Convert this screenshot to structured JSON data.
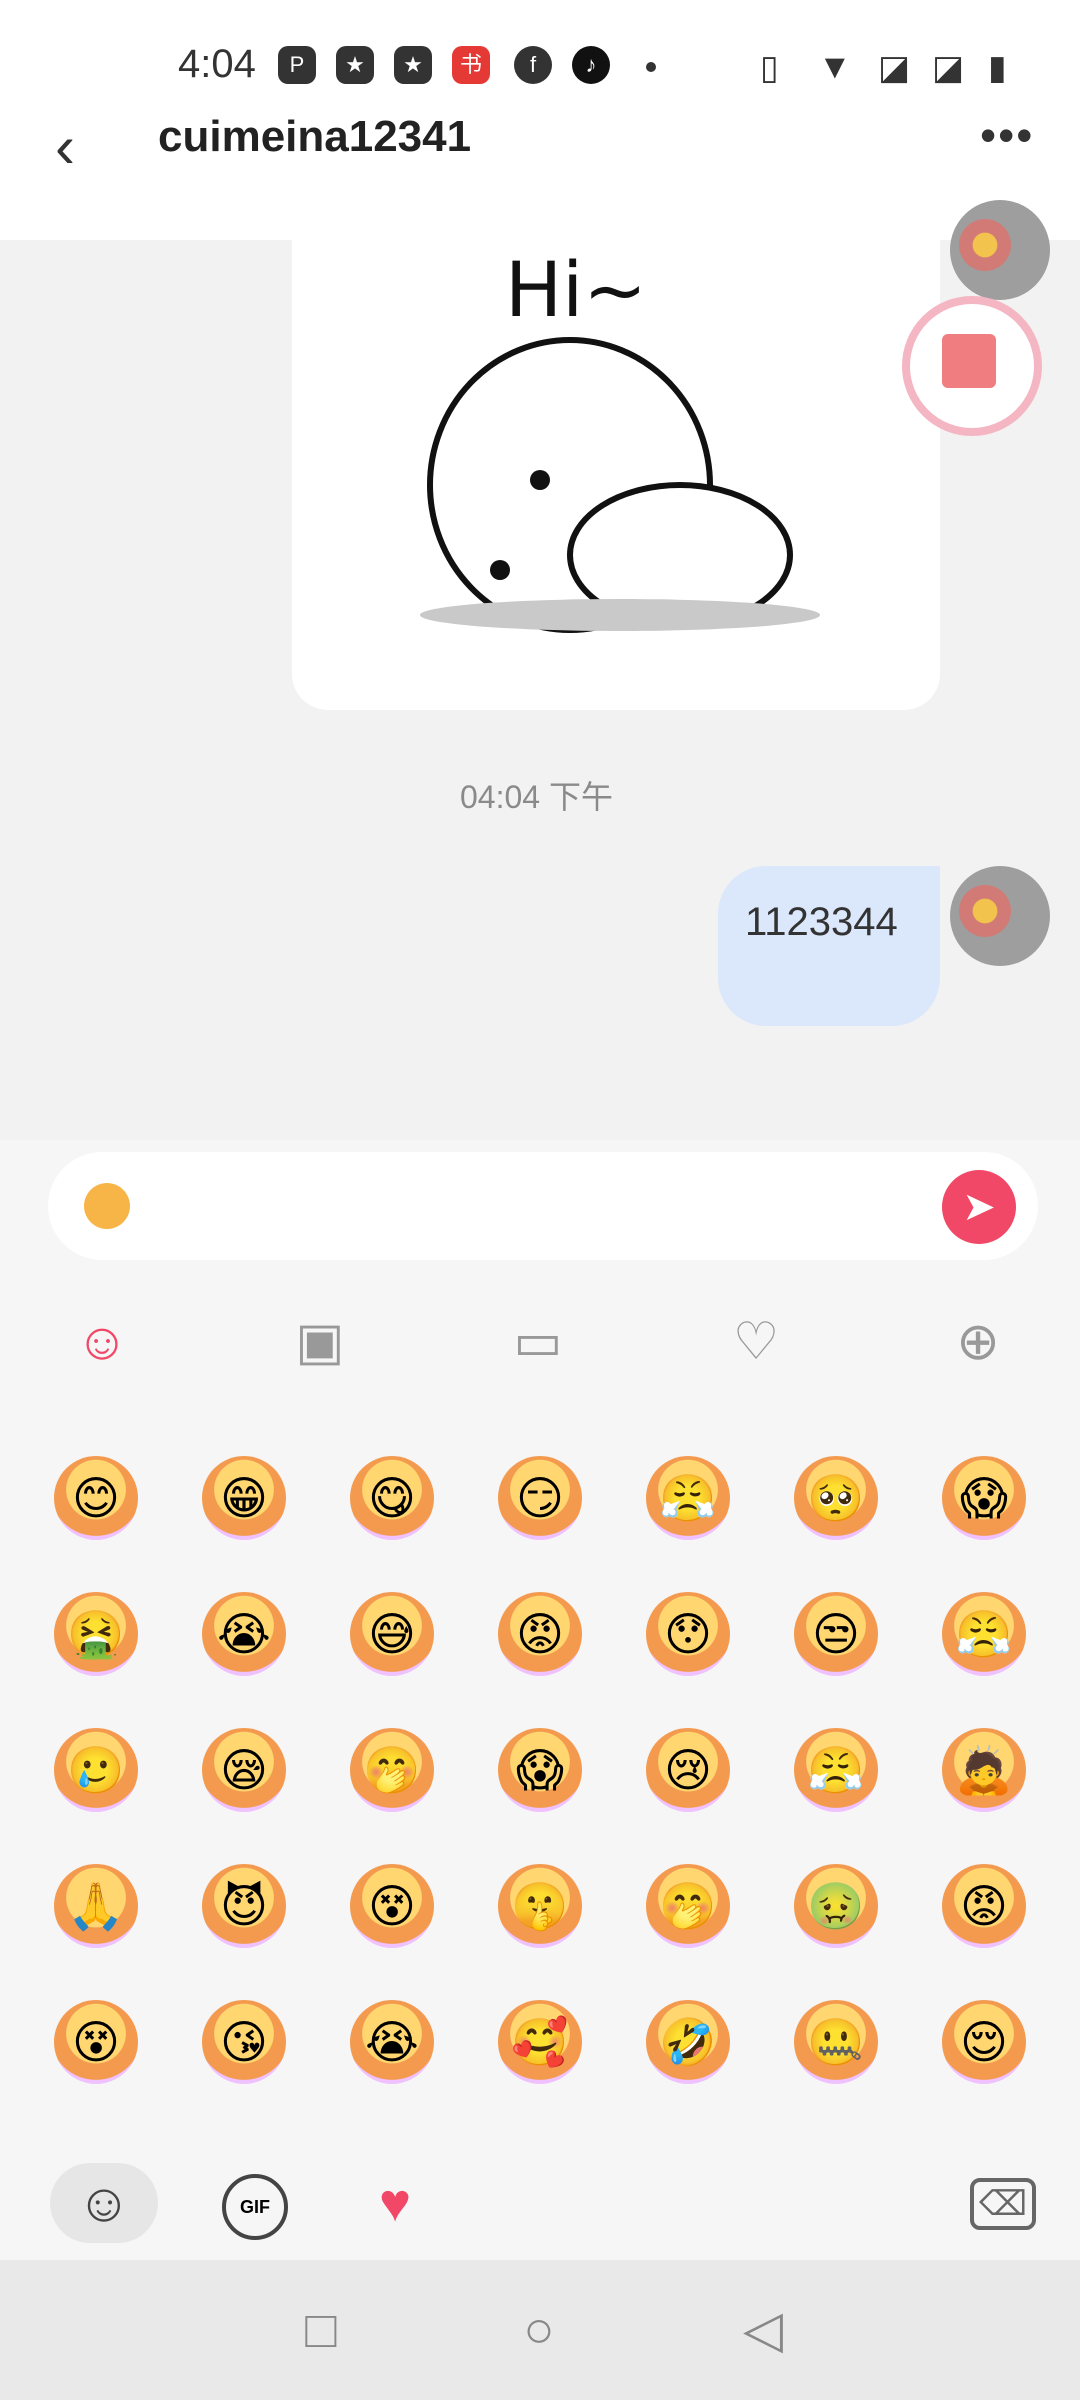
{
  "status": {
    "time": "4:04"
  },
  "header": {
    "title": "cuimeina12341"
  },
  "chat": {
    "sticker_text": "Hi~",
    "timestamp": "04:04 下午",
    "sent_message": "1123344"
  },
  "composer": {
    "value_icon": "smiling-face-emoji",
    "send_icon": "send-arrow-icon"
  },
  "toolbar": {
    "items": [
      "emoji-icon",
      "image-icon",
      "gift-icon",
      "broken-heart-icon",
      "plus-icon"
    ]
  },
  "emoji_grid": {
    "rows": [
      [
        "😊",
        "😁",
        "😋",
        "😏",
        "😤",
        "🥺",
        "😱"
      ],
      [
        "🤮",
        "😭",
        "😅",
        "😡",
        "😯",
        "😒",
        "😤"
      ],
      [
        "🥲",
        "😪",
        "🤭",
        "😱",
        "😢",
        "😤",
        "🙇"
      ],
      [
        "🙏",
        "😈",
        "😵",
        "🤫",
        "🤭",
        "🤢",
        "😡"
      ],
      [
        "😵",
        "😘",
        "😭",
        "🥰",
        "🤣",
        "🤐",
        "😌"
      ]
    ]
  },
  "bottom_tabs": {
    "gif_label": "GIF"
  },
  "colors": {
    "accent": "#f04866",
    "bubble": "#dbe7fb"
  }
}
